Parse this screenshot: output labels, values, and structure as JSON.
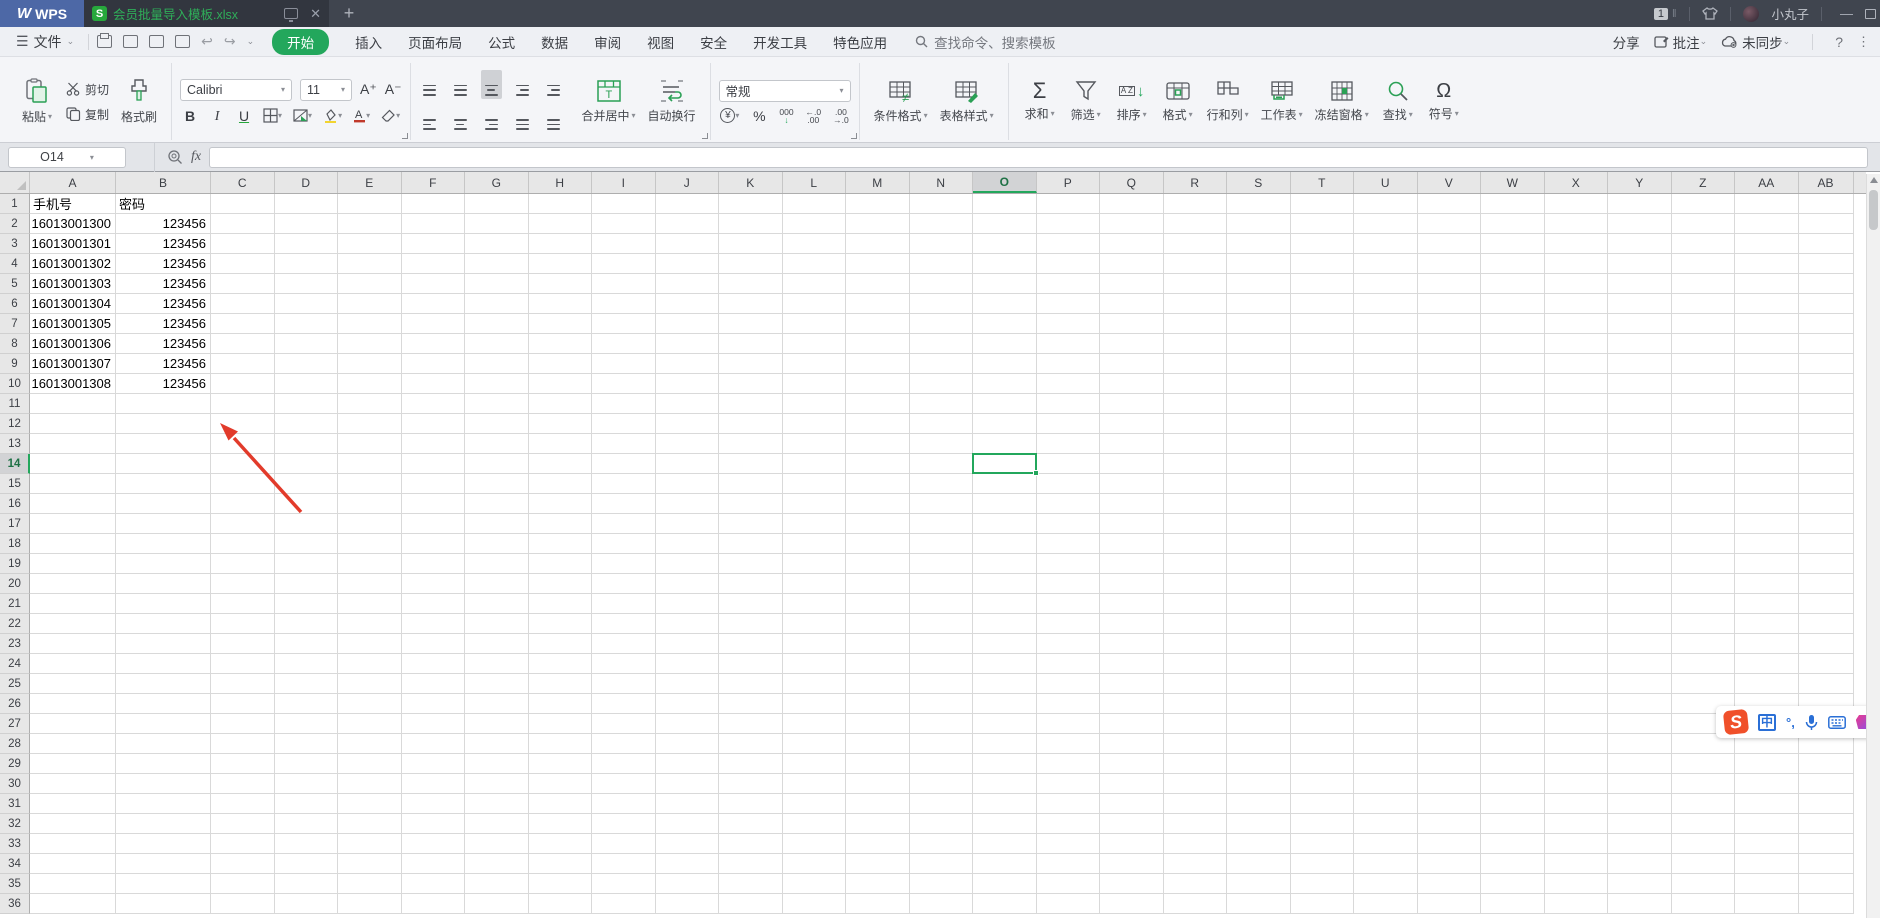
{
  "colors": {
    "accent_green": "#23a75c",
    "wps_blue": "#4d68a6",
    "titlebar_bg": "#40454f",
    "arrow_red": "#e23b2b",
    "ime_blue": "#2a6fd6",
    "sogou_orange": "#f0502a"
  },
  "titlebar": {
    "app_name": "WPS",
    "doc_tab": {
      "title": "会员批量导入模板.xlsx"
    },
    "new_tab_label": "+",
    "right": {
      "badge": "1",
      "user_name": "小丸子",
      "minimize": "—"
    }
  },
  "menubar": {
    "file_label": "文件",
    "tabs": [
      {
        "label": "开始",
        "active": true
      },
      {
        "label": "插入"
      },
      {
        "label": "页面布局"
      },
      {
        "label": "公式"
      },
      {
        "label": "数据"
      },
      {
        "label": "审阅"
      },
      {
        "label": "视图"
      },
      {
        "label": "安全"
      },
      {
        "label": "开发工具"
      },
      {
        "label": "特色应用"
      }
    ],
    "search_placeholder": "查找命令、搜索模板",
    "share_label": "分享",
    "comment_label": "批注",
    "sync_label": "未同步",
    "help_label": "?",
    "more_label": "⋮"
  },
  "ribbon": {
    "paste_label": "粘贴",
    "cut_label": "剪切",
    "copy_label": "复制",
    "format_painter_label": "格式刷",
    "font_name": "Calibri",
    "font_size": "11",
    "grow_font": "A⁺",
    "shrink_font": "A⁻",
    "bold": "B",
    "italic": "I",
    "underline": "U",
    "merge_label": "合并居中",
    "wrap_label": "自动换行",
    "number_format": "常规",
    "currency": "¥",
    "percent": "%",
    "thousands": "000",
    "dec_decimal_top": "←.0",
    "dec_decimal_bot": ".00",
    "inc_decimal_top": ".00",
    "inc_decimal_bot": "→.0",
    "cond_format_label": "条件格式",
    "table_style_label": "表格样式",
    "sum_label": "求和",
    "sum_glyph": "Σ",
    "filter_label": "筛选",
    "sort_label": "排序",
    "sort_az": "A Z",
    "format_label": "格式",
    "rows_cols_label": "行和列",
    "sheet_label": "工作表",
    "freeze_label": "冻结窗格",
    "find_label": "查找",
    "symbol_label": "符号",
    "symbol_glyph": "Ω"
  },
  "formula_bar": {
    "name_box": "O14",
    "fx_label": "fx",
    "input_value": ""
  },
  "sheet": {
    "columns": [
      "A",
      "B",
      "C",
      "D",
      "E",
      "F",
      "G",
      "H",
      "I",
      "J",
      "K",
      "L",
      "M",
      "N",
      "O",
      "P",
      "Q",
      "R",
      "S",
      "T",
      "U",
      "V",
      "W",
      "X",
      "Y",
      "Z",
      "AA",
      "AB"
    ],
    "visible_rows": 36,
    "selected_cell": {
      "column": "O",
      "row": 14,
      "name": "O14"
    },
    "table": {
      "headers": [
        "手机号",
        "密码"
      ],
      "records": [
        [
          "16013001300",
          "123456"
        ],
        [
          "16013001301",
          "123456"
        ],
        [
          "16013001302",
          "123456"
        ],
        [
          "16013001303",
          "123456"
        ],
        [
          "16013001304",
          "123456"
        ],
        [
          "16013001305",
          "123456"
        ],
        [
          "16013001306",
          "123456"
        ],
        [
          "16013001307",
          "123456"
        ],
        [
          "16013001308",
          "123456"
        ]
      ]
    }
  },
  "ime_bar": {
    "mode_label": "中",
    "punct_label": "°,"
  }
}
